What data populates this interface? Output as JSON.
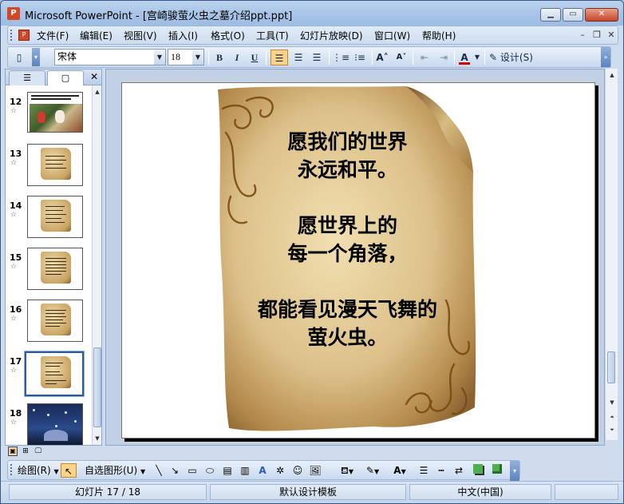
{
  "window": {
    "title": "Microsoft PowerPoint - [宫崎骏萤火虫之墓介绍ppt.ppt]",
    "app_icon": "P"
  },
  "menu": {
    "items": [
      "文件(F)",
      "编辑(E)",
      "视图(V)",
      "插入(I)",
      "格式(O)",
      "工具(T)",
      "幻灯片放映(D)",
      "窗口(W)",
      "帮助(H)"
    ]
  },
  "toolbar": {
    "font_name": "宋体",
    "font_size": "18",
    "bold": "B",
    "italic": "I",
    "underline": "U",
    "font_color_label": "A",
    "design_label": "设计(S)"
  },
  "slides_panel": {
    "tabs": [
      "outline-tab",
      "slides-tab"
    ],
    "active_tab": "slides-tab",
    "thumbnails": [
      {
        "number": "12",
        "kind": "photo"
      },
      {
        "number": "13",
        "kind": "parchment"
      },
      {
        "number": "14",
        "kind": "parchment"
      },
      {
        "number": "15",
        "kind": "parchment"
      },
      {
        "number": "16",
        "kind": "parchment"
      },
      {
        "number": "17",
        "kind": "parchment",
        "selected": true
      },
      {
        "number": "18",
        "kind": "photo-night"
      }
    ]
  },
  "slide": {
    "lines": [
      "愿我们的世界",
      "永远和平。",
      "",
      "愿世界上的",
      "每一个角落，",
      "",
      "都能看见漫天飞舞的",
      "萤火虫。"
    ]
  },
  "drawing_toolbar": {
    "draw_label": "绘图(R)",
    "autoshapes_label": "自选图形(U)"
  },
  "status": {
    "slide_position": "幻灯片 17 / 18",
    "template": "默认设计模板",
    "language": "中文(中国)"
  },
  "colors": {
    "accent_selection": "#f9d38a",
    "selected_thumb_border": "#2c5aa0",
    "font_color_bar": "#cc0000",
    "parchment": "#d9be84"
  }
}
